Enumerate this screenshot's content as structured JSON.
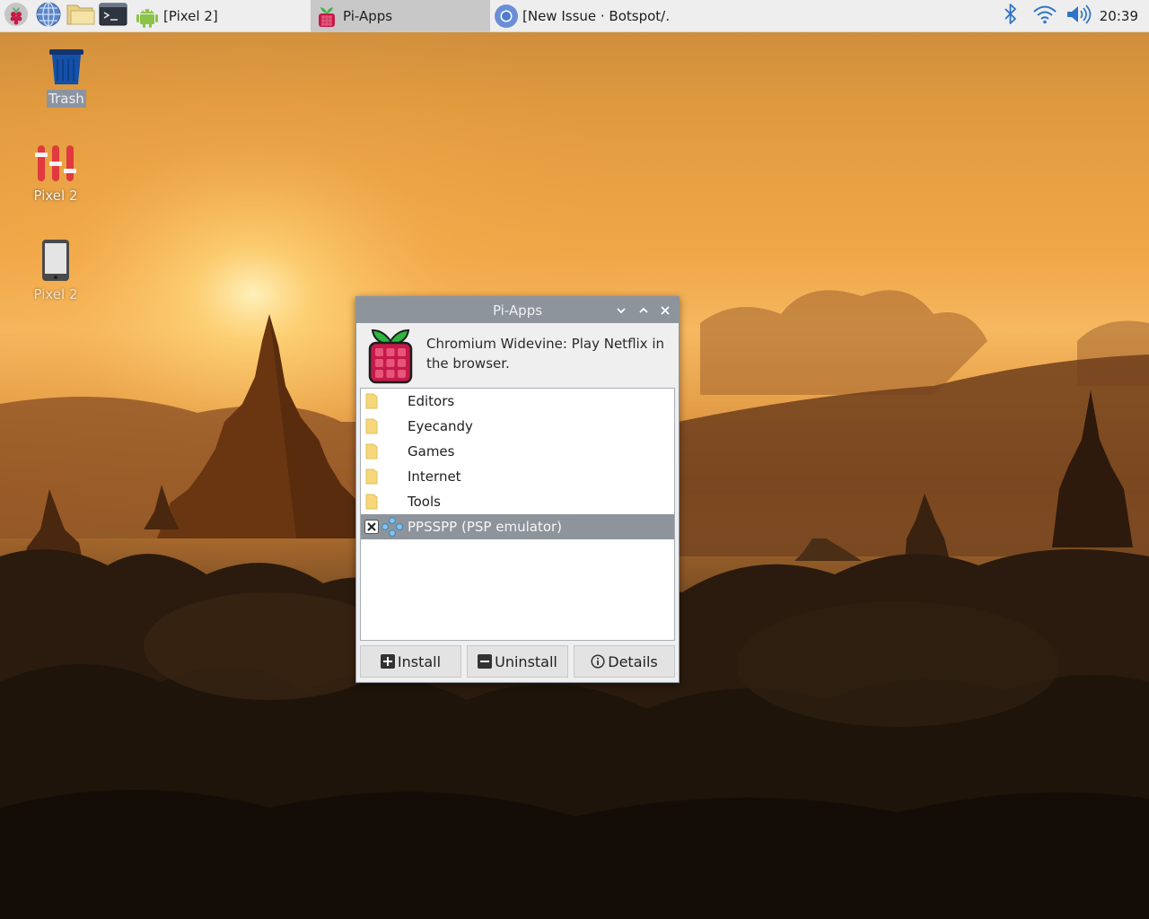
{
  "taskbar": {
    "launchers": [
      {
        "icon": "raspberry-menu-icon"
      },
      {
        "icon": "web-browser-icon"
      },
      {
        "icon": "file-manager-icon"
      },
      {
        "icon": "terminal-icon"
      }
    ],
    "tasks": [
      {
        "label": "[Pixel 2]",
        "icon": "android-icon"
      },
      {
        "label": "Pi-Apps",
        "icon": "raspberry-icon"
      },
      {
        "label": "[New Issue · Botspot/…",
        "icon": "chromium-icon"
      }
    ],
    "tray": {
      "clock": "20:39"
    }
  },
  "desktop": {
    "icons": [
      {
        "label": "Trash",
        "icon": "trash-icon"
      },
      {
        "label": "Pixel 2",
        "icon": "pixel2-sliders-icon"
      },
      {
        "label": "Pixel 2",
        "icon": "phone-icon"
      }
    ]
  },
  "window": {
    "title": "Pi-Apps",
    "description": "Chromium Widevine: Play Netflix in the browser.",
    "list": [
      {
        "label": "Editors",
        "icon": "folder-icon"
      },
      {
        "label": "Eyecandy",
        "icon": "folder-icon"
      },
      {
        "label": "Games",
        "icon": "folder-icon"
      },
      {
        "label": "Internet",
        "icon": "folder-icon"
      },
      {
        "label": "Tools",
        "icon": "folder-icon"
      },
      {
        "label": "PPSSPP (PSP emulator)",
        "icon": "ppsspp-icon",
        "status_icon": "uninstalled-x-icon",
        "selected": true
      }
    ],
    "buttons": {
      "install": "Install",
      "uninstall": "Uninstall",
      "details": "Details"
    }
  },
  "colors": {
    "taskbar_bg": "#eeeeee",
    "titlebar": "#8e949c",
    "selection": "#8e949c"
  }
}
